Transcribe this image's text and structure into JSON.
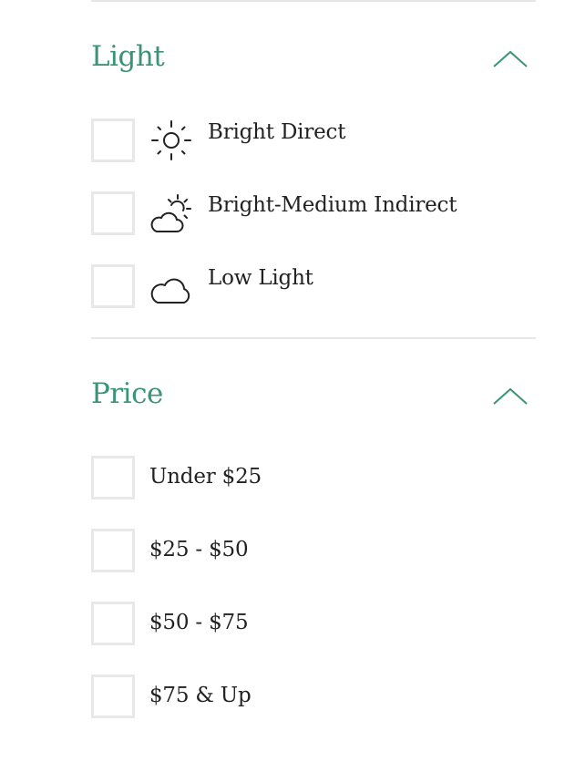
{
  "sections": {
    "light": {
      "title": "Light",
      "options": [
        {
          "label": "Bright Direct",
          "icon": "sun-icon"
        },
        {
          "label": "Bright-Medium Indirect",
          "icon": "partly-cloudy-icon"
        },
        {
          "label": "Low Light",
          "icon": "cloud-icon"
        }
      ]
    },
    "price": {
      "title": "Price",
      "options": [
        {
          "label": "Under $25"
        },
        {
          "label": "$25 - $50"
        },
        {
          "label": "$50 - $75"
        },
        {
          "label": "$75 & Up"
        }
      ]
    }
  },
  "colors": {
    "accent": "#3b9476",
    "text": "#222222",
    "checkbox_border": "#e8e8e8",
    "divider": "#e6e6e6"
  }
}
